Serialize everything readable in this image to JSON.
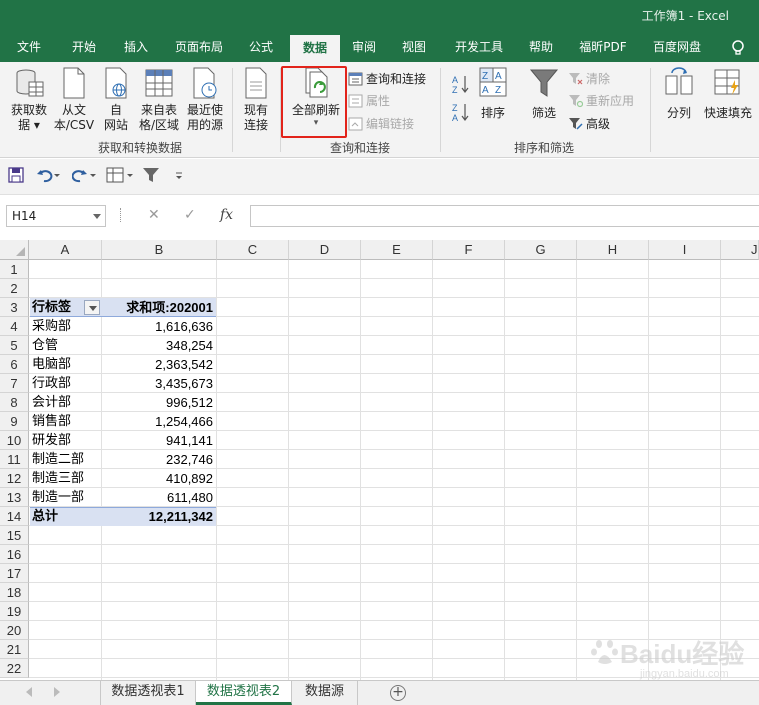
{
  "window": {
    "title": "工作簿1  -  Excel"
  },
  "tabs": [
    "文件",
    "开始",
    "插入",
    "页面布局",
    "公式",
    "数据",
    "审阅",
    "视图",
    "开发工具",
    "帮助",
    "福昕PDF",
    "百度网盘"
  ],
  "active_tab": "数据",
  "ribbon": {
    "get_data": [
      "获取数",
      "据 ▾"
    ],
    "from_text": [
      "从文",
      "本/CSV"
    ],
    "from_web": [
      "自",
      "网站"
    ],
    "from_table": [
      "来自表",
      "格/区域"
    ],
    "recent_sources": [
      "最近使",
      "用的源"
    ],
    "existing_connections": [
      "现有",
      "连接"
    ],
    "refresh_all": [
      "全部刷新",
      "▾"
    ],
    "queries_connections": "查询和连接",
    "properties": "属性",
    "edit_links": "编辑链接",
    "sort": "排序",
    "filter": "筛选",
    "clear": "清除",
    "reapply": "重新应用",
    "advanced": "高级",
    "text_to_columns": "分列",
    "flash_fill": "快速填充",
    "group_get_transform": "获取和转换数据",
    "group_queries": "查询和连接",
    "group_sort_filter": "排序和筛选"
  },
  "formula_bar": {
    "name_box": "H14",
    "formula": ""
  },
  "columns": [
    "A",
    "B",
    "C",
    "D",
    "E",
    "F",
    "G",
    "H",
    "I",
    "J"
  ],
  "rows": [
    "1",
    "2",
    "3",
    "4",
    "5",
    "6",
    "7",
    "8",
    "9",
    "10",
    "11",
    "12",
    "13",
    "14",
    "15",
    "16",
    "17",
    "18",
    "19",
    "20",
    "21",
    "22"
  ],
  "pivot": {
    "header_label": "行标签",
    "header_value": "求和项:202001",
    "rows": [
      {
        "label": "采购部",
        "value": "1,616,636"
      },
      {
        "label": "仓管",
        "value": "348,254"
      },
      {
        "label": "电脑部",
        "value": "2,363,542"
      },
      {
        "label": "行政部",
        "value": "3,435,673"
      },
      {
        "label": "会计部",
        "value": "996,512"
      },
      {
        "label": "销售部",
        "value": "1,254,466"
      },
      {
        "label": "研发部",
        "value": "941,141"
      },
      {
        "label": "制造二部",
        "value": "232,746"
      },
      {
        "label": "制造三部",
        "value": "410,892"
      },
      {
        "label": "制造一部",
        "value": "611,480"
      }
    ],
    "total_label": "总计",
    "total_value": "12,211,342"
  },
  "sheets": [
    "数据透视表1",
    "数据透视表2",
    "数据源"
  ],
  "active_sheet": "数据透视表2",
  "watermark": {
    "text": "Baidu经验",
    "sub": "jingyan.baidu.com"
  },
  "colors": {
    "brand": "#217346",
    "highlight": "#e2231a",
    "pivot_fill": "#d9e1f2"
  }
}
